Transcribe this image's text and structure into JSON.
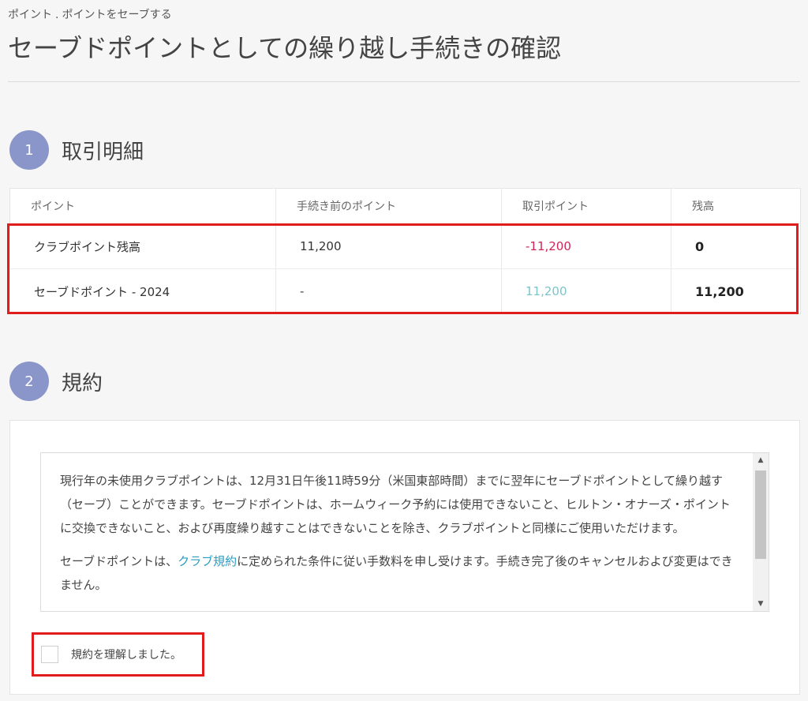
{
  "breadcrumb": {
    "items": [
      "ポイント",
      "ポイントをセーブする"
    ],
    "separator": "."
  },
  "page_title": "セーブドポイントとしての繰り越し手続きの確認",
  "steps": [
    {
      "number": "1",
      "label": "取引明細"
    },
    {
      "number": "2",
      "label": "規約"
    }
  ],
  "transaction_table": {
    "headers": [
      "ポイント",
      "手続き前のポイント",
      "取引ポイント",
      "残高"
    ],
    "rows": [
      {
        "point": "クラブポイント残高",
        "before": "11,200",
        "transaction": "-11,200",
        "balance": "0"
      },
      {
        "point": "セーブドポイント - 2024",
        "before": "-",
        "transaction": "11,200",
        "balance": "11,200"
      }
    ]
  },
  "terms": {
    "paragraph1": "現行年の未使用クラブポイントは、12月31日午後11時59分（米国東部時間）までに翌年にセーブドポイントとして繰り越す（セーブ）ことができます。セーブドポイントは、ホームウィーク予約には使用できないこと、ヒルトン・オナーズ・ポイントに交換できないこと、および再度繰り越すことはできないことを除き、クラブポイントと同様にご使用いただけます。",
    "paragraph2_before": "セーブドポイントは、",
    "paragraph2_link": "クラブ規約",
    "paragraph2_after": "に定められた条件に従い手数料を申し受けます。手続き完了後のキャンセルおよび変更はできません。",
    "scroll_up_icon": "▲",
    "scroll_down_icon": "▼"
  },
  "agreement": {
    "label": "規約を理解しました。",
    "checked": false
  },
  "colors": {
    "step_circle": "#8a95c9",
    "negative": "#d0245a",
    "positive": "#7cc5c8",
    "link": "#2a9dc2",
    "highlight": "#e01c1c"
  }
}
